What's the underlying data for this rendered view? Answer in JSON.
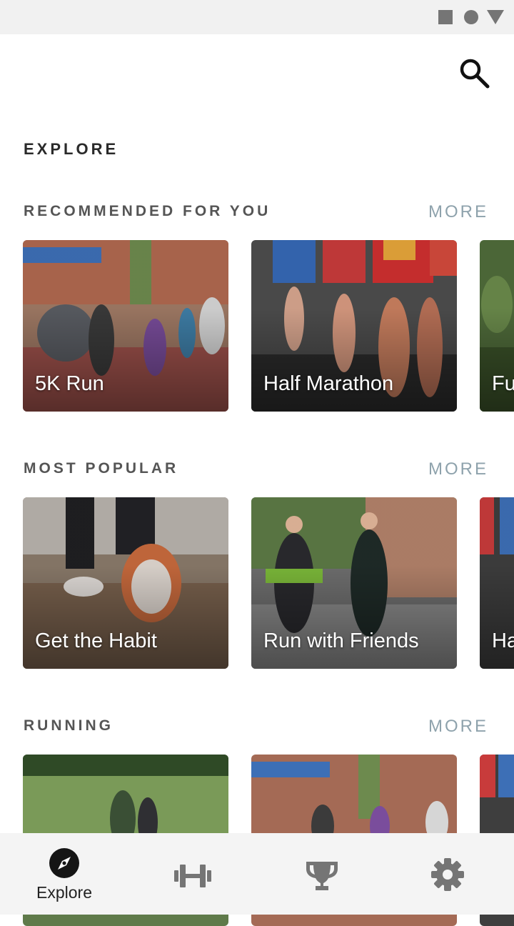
{
  "status_bar": {
    "icons": [
      "square-icon",
      "circle-icon",
      "triangle-icon"
    ]
  },
  "header": {
    "title": "EXPLORE",
    "search_icon": "search-icon"
  },
  "sections": [
    {
      "title": "RECOMMENDED FOR YOU",
      "more_label": "MORE",
      "cards": [
        {
          "label": "5K Run"
        },
        {
          "label": "Half Marathon"
        },
        {
          "label": "Fu"
        }
      ]
    },
    {
      "title": "MOST POPULAR",
      "more_label": "MORE",
      "cards": [
        {
          "label": "Get the Habit"
        },
        {
          "label": "Run with Friends"
        },
        {
          "label": "Ha"
        }
      ]
    },
    {
      "title": "RUNNING",
      "more_label": "MORE",
      "cards": [
        {
          "label": ""
        },
        {
          "label": ""
        },
        {
          "label": ""
        }
      ]
    }
  ],
  "bottom_nav": {
    "items": [
      {
        "label": "Explore",
        "icon": "compass-icon",
        "active": true
      },
      {
        "label": "",
        "icon": "dumbbell-icon"
      },
      {
        "label": "",
        "icon": "trophy-icon"
      },
      {
        "label": "",
        "icon": "gear-icon"
      }
    ]
  },
  "colors": {
    "more_link": "#8ea2ac",
    "nav_bg": "#f4f4f4",
    "status_bar_bg": "#f1f1f1"
  }
}
